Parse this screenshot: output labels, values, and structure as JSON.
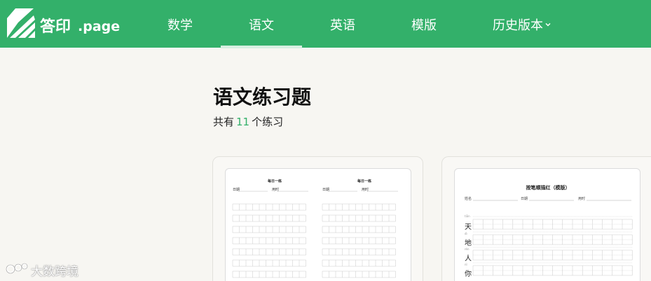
{
  "brand": {
    "name_cn": "答印",
    "name_en": ".page",
    "logo_icon": "book-pages-icon"
  },
  "nav": {
    "items": [
      {
        "label": "数学"
      },
      {
        "label": "语文",
        "active": true
      },
      {
        "label": "英语"
      },
      {
        "label": "模版"
      },
      {
        "label": "历史版本",
        "dropdown": true,
        "icon": "chevron-down-icon"
      }
    ],
    "colors": {
      "bar": "#33b06a",
      "active_underline": "#d7efe1"
    }
  },
  "main": {
    "title": "语文练习题",
    "count_prefix": "共有",
    "count": "11",
    "count_suffix": "个练习"
  },
  "cards": [
    {
      "preview": {
        "left_title": "每日一练",
        "right_title": "每日一练",
        "field1": "日期",
        "field2": "用时"
      }
    },
    {
      "preview": {
        "title": "按笔顺描红（模版）",
        "field_name": "姓名",
        "field_date": "日期",
        "field_time": "用时",
        "chars": [
          "天",
          "地",
          "人",
          "你"
        ],
        "pinyin": [
          "tiān",
          "dì",
          "rén",
          "nǐ"
        ]
      }
    }
  ],
  "watermark": {
    "text": "大数跨境",
    "icon": "brand-logo-icon"
  }
}
